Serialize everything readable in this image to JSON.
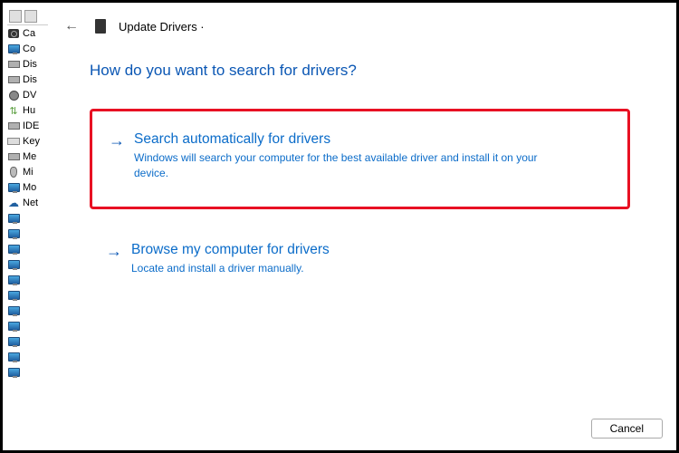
{
  "tree": {
    "items": [
      "Ca",
      "Co",
      "Dis",
      "Dis",
      "DV",
      "Hu",
      "IDE",
      "Key",
      "Me",
      "Mi",
      "Mo",
      "Net"
    ]
  },
  "dialog": {
    "title": "Update Drivers ·",
    "heading": "How do you want to search for drivers?",
    "options": [
      {
        "title": "Search automatically for drivers",
        "desc": "Windows will search your computer for the best available driver and install it on your device."
      },
      {
        "title": "Browse my computer for drivers",
        "desc": "Locate and install a driver manually."
      }
    ],
    "cancel": "Cancel"
  }
}
